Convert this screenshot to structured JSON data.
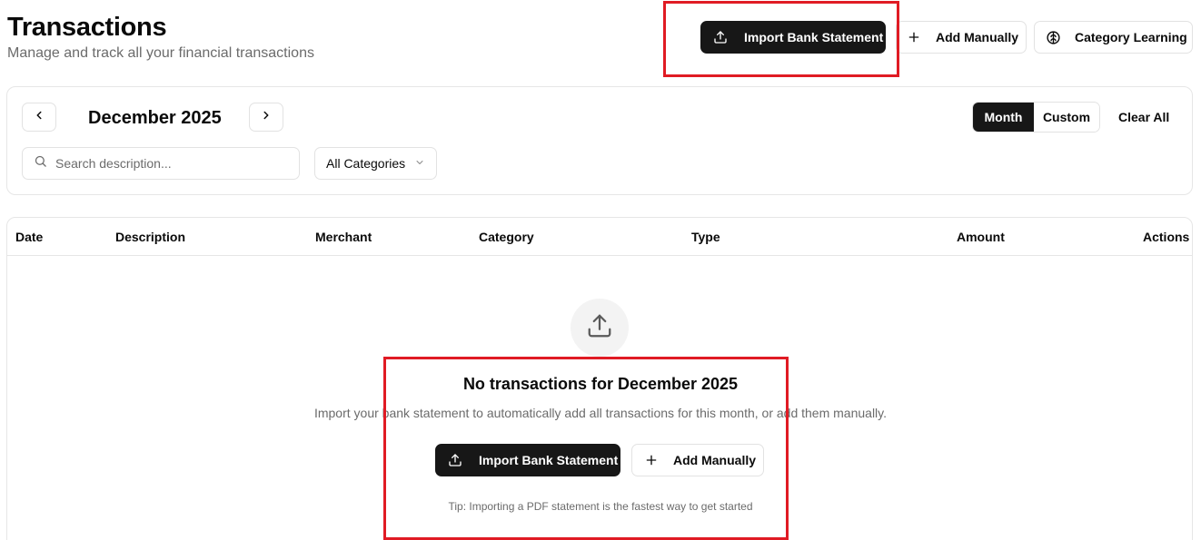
{
  "header": {
    "title": "Transactions",
    "subtitle": "Manage and track all your financial transactions",
    "actions": {
      "import_label": "Import Bank Statement",
      "add_label": "Add Manually",
      "learning_label": "Category Learning"
    }
  },
  "filters": {
    "month_label": "December 2025",
    "view_modes": [
      "Month",
      "Custom"
    ],
    "active_view": "Month",
    "clear_label": "Clear All",
    "search_placeholder": "Search description...",
    "category_value": "All Categories"
  },
  "table": {
    "columns": [
      "Date",
      "Description",
      "Merchant",
      "Category",
      "Type",
      "Amount",
      "Actions"
    ]
  },
  "empty_state": {
    "title": "No transactions for December 2025",
    "description": "Import your bank statement to automatically add all transactions for this month, or add them manually.",
    "import_label": "Import Bank Statement",
    "add_label": "Add Manually",
    "tip": "Tip: Importing a PDF statement is the fastest way to get started"
  },
  "colors": {
    "primary_dark": "#171717",
    "highlight_red": "#e01b24",
    "muted_text": "#6b6b6b",
    "border": "#e2e2e2"
  },
  "icons": {
    "upload": "upload-icon",
    "plus": "plus-icon",
    "brain": "brain-icon",
    "chevron_left": "chevron-left-icon",
    "chevron_right": "chevron-right-icon",
    "search": "search-icon",
    "chevron_down": "chevron-down-icon"
  }
}
